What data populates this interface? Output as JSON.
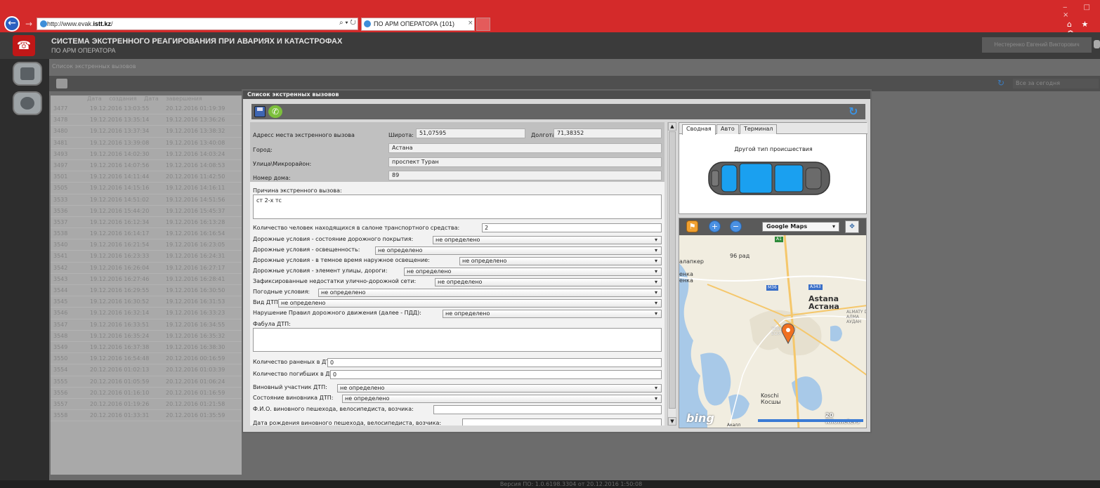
{
  "browser": {
    "url_prefix": "http://www.evak.",
    "url_domain": "istt.kz",
    "url_suffix": "/",
    "url_tools": "⌕ ▾ ↻",
    "tab_title": "ПО АРМ ОПЕРАТОРА (101)",
    "tab_close": "×",
    "window_controls": "‒ □ ×",
    "toolbar_icons": "⌂ ★ ⚙"
  },
  "app": {
    "title": "СИСТЕМА ЭКСТРЕННОГО РЕАГИРОВАНИЯ ПРИ АВАРИЯХ И КАТАСТРОФАХ",
    "subtitle": "ПО АРМ ОПЕРАТОРА",
    "user": "Нестеренко Евгений Викторович",
    "footer_version": "Версия ПО: 1.0.6198.3304 от 20.12.2016 1:50:08"
  },
  "background_list": {
    "title": "Список экстренных вызовов",
    "filter": "Все за сегодня",
    "columns": [
      "Дата создания",
      "Дата завершения"
    ],
    "rows": [
      {
        "id": "3477",
        "created": "19.12.2016 13:03:55",
        "closed": "20.12.2016 01:19:39"
      },
      {
        "id": "3478",
        "created": "19.12.2016 13:35:14",
        "closed": "19.12.2016 13:36:26"
      },
      {
        "id": "3480",
        "created": "19.12.2016 13:37:34",
        "closed": "19.12.2016 13:38:32"
      },
      {
        "id": "3481",
        "created": "19.12.2016 13:39:08",
        "closed": "19.12.2016 13:40:08"
      },
      {
        "id": "3493",
        "created": "19.12.2016 14:02:30",
        "closed": "19.12.2016 14:03:24"
      },
      {
        "id": "3497",
        "created": "19.12.2016 14:07:56",
        "closed": "19.12.2016 14:08:53"
      },
      {
        "id": "3501",
        "created": "19.12.2016 14:11:44",
        "closed": "20.12.2016 11:42:50"
      },
      {
        "id": "3505",
        "created": "19.12.2016 14:15:16",
        "closed": "19.12.2016 14:16:11"
      },
      {
        "id": "3533",
        "created": "19.12.2016 14:51:02",
        "closed": "19.12.2016 14:51:56"
      },
      {
        "id": "3536",
        "created": "19.12.2016 15:44:20",
        "closed": "19.12.2016 15:45:37"
      },
      {
        "id": "3537",
        "created": "19.12.2016 16:12:34",
        "closed": "19.12.2016 16:13:28"
      },
      {
        "id": "3538",
        "created": "19.12.2016 16:14:17",
        "closed": "19.12.2016 16:16:54"
      },
      {
        "id": "3540",
        "created": "19.12.2016 16:21:54",
        "closed": "19.12.2016 16:23:05"
      },
      {
        "id": "3541",
        "created": "19.12.2016 16:23:33",
        "closed": "19.12.2016 16:24:31"
      },
      {
        "id": "3542",
        "created": "19.12.2016 16:26:04",
        "closed": "19.12.2016 16:27:17"
      },
      {
        "id": "3543",
        "created": "19.12.2016 16:27:46",
        "closed": "19.12.2016 16:28:41"
      },
      {
        "id": "3544",
        "created": "19.12.2016 16:29:55",
        "closed": "19.12.2016 16:30:50"
      },
      {
        "id": "3545",
        "created": "19.12.2016 16:30:52",
        "closed": "19.12.2016 16:31:53"
      },
      {
        "id": "3546",
        "created": "19.12.2016 16:32:14",
        "closed": "19.12.2016 16:33:23"
      },
      {
        "id": "3547",
        "created": "19.12.2016 16:33:51",
        "closed": "19.12.2016 16:34:55"
      },
      {
        "id": "3548",
        "created": "19.12.2016 16:35:24",
        "closed": "19.12.2016 16:35:32"
      },
      {
        "id": "3549",
        "created": "19.12.2016 16:37:38",
        "closed": "19.12.2016 16:38:30"
      },
      {
        "id": "3550",
        "created": "19.12.2016 16:54:48",
        "closed": "20.12.2016 00:16:59"
      },
      {
        "id": "3554",
        "created": "20.12.2016 01:02:13",
        "closed": "20.12.2016 01:03:39"
      },
      {
        "id": "3555",
        "created": "20.12.2016 01:05:59",
        "closed": "20.12.2016 01:06:24"
      },
      {
        "id": "3556",
        "created": "20.12.2016 01:16:10",
        "closed": "20.12.2016 01:16:59"
      },
      {
        "id": "3557",
        "created": "20.12.2016 01:19:26",
        "closed": "20.12.2016 01:21:58"
      },
      {
        "id": "3558",
        "created": "20.12.2016 01:33:31",
        "closed": "20.12.2016 01:35:59"
      }
    ]
  },
  "modal": {
    "title": "Список экстренных вызовов",
    "address_label": "Адресс места экстренного вызова",
    "lat_label": "Широта:",
    "lat_value": "51,07595",
    "lon_label": "Долгота:",
    "lon_value": "71,38352",
    "city_label": "Город:",
    "city_value": "Астана",
    "street_label": "Улица\\Микрорайон:",
    "street_value": "проспект Туран",
    "house_label": "Номер дома:",
    "house_value": "89",
    "reason_label": "Причина экстренного вызова:",
    "reason_value": "ст 2-х тс",
    "people_label": "Количество человек находящихся в салоне транспортного средства:",
    "people_value": "2",
    "road_cover_label": "Дорожные условия - состояние дорожного покрытия:",
    "road_cover_value": "не определено",
    "lighting_label": "Дорожные условия - освещенность:",
    "lighting_value": "не определено",
    "night_light_label": "Дорожные условия - в темное время наружное освещение:",
    "night_light_value": "не определено",
    "street_element_label": "Дорожные условия - элемент улицы, дороги:",
    "street_element_value": "не определено",
    "defects_label": "Зафиксированные недостатки улично-дорожной сети:",
    "defects_value": "не определено",
    "weather_label": "Погодные условия:",
    "weather_value": "не определено",
    "accident_type_label": "Вид ДТП:",
    "accident_type_value": "не определено",
    "violation_label": "Нарушение Правил дорожного движения (далее - ПДД):",
    "violation_value": "не определено",
    "plot_label": "Фабула ДТП:",
    "plot_value": "",
    "injured_label": "Количество раненых в ДТП:",
    "injured_value": "0",
    "killed_label": "Количество погибших в ДТП:",
    "killed_value": "0",
    "culprit_label": "Виновный участник ДТП:",
    "culprit_value": "не определено",
    "culprit_state_label": "Состояние виновника ДТП:",
    "culprit_state_value": "не определено",
    "pedestrian_name_label": "Ф.И.О. виновного пешехода, велосипедиста, возчика:",
    "pedestrian_name_value": "",
    "pedestrian_dob_label": "Дата рождения виновного пешехода, велосипедиста, возчика:",
    "pedestrian_dob_value": ""
  },
  "right_panel": {
    "tabs": [
      "Сводная",
      "Авто",
      "Терминал"
    ],
    "incident_type": "Другой тип происшествия",
    "car_color": "#1aa0f0"
  },
  "map": {
    "provider": "Google Maps",
    "labels": {
      "a1": "A1",
      "rad": "96 рад",
      "alakr": "алапкер",
      "enka": "енка\nенка",
      "m36": "M36",
      "a343": "A343",
      "astana_lat": "Astana",
      "astana_cyr": "Астана",
      "almaty": "ALMATY D\nАЛМА\nАУДАН",
      "yesil": "YESIL     ICT\nЕСІЛ     ЫЫ",
      "koschi": "Koschi\nКосшы",
      "aqsay": "Акалл",
      "scale": "20 Kilometers",
      "logo": "bing"
    },
    "accent_water": "#a8c9e8",
    "pin_color": "#f07020"
  }
}
